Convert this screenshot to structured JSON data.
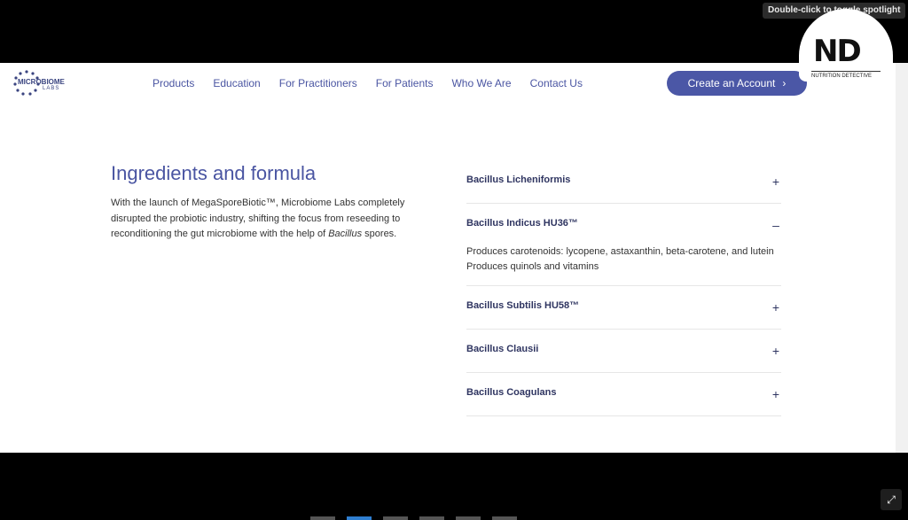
{
  "overlay": {
    "spotlight_hint": "Double-click to toggle spotlight",
    "expand_icon": "expand-icon"
  },
  "header": {
    "logo_main": "MICROBIOME",
    "logo_sub": "LABS",
    "nav": [
      "Products",
      "Education",
      "For Practitioners",
      "For Patients",
      "Who We Are",
      "Contact Us"
    ],
    "cta_label": "Create an Account",
    "cta_icon": "chevron-right-icon"
  },
  "badge": {
    "mark": "ND",
    "label": "NUTRITION DETECTIVE"
  },
  "content": {
    "title": "Ingredients and formula",
    "body_text": "With the launch of MegaSporeBiotic™, Microbiome Labs completely disrupted the probiotic industry, shifting the focus from reseeding to reconditioning the gut microbiome with the help of",
    "body_italic": "Bacillus",
    "body_suffix": " spores."
  },
  "accordion": [
    {
      "title": "Bacillus Licheniformis",
      "toggle": "+",
      "open": false,
      "lines": []
    },
    {
      "title": "Bacillus Indicus HU36™",
      "toggle": "–",
      "open": true,
      "lines": [
        "Produces carotenoids: lycopene, astaxanthin, beta-carotene, and lutein",
        "Produces quinols and vitamins"
      ]
    },
    {
      "title": "Bacillus Subtilis HU58™",
      "toggle": "+",
      "open": false,
      "lines": []
    },
    {
      "title": "Bacillus Clausii",
      "toggle": "+",
      "open": false,
      "lines": []
    },
    {
      "title": "Bacillus Coagulans",
      "toggle": "+",
      "open": false,
      "lines": []
    }
  ],
  "colors": {
    "brand": "#4b57a6",
    "heading": "#2f3561",
    "text": "#333333"
  }
}
